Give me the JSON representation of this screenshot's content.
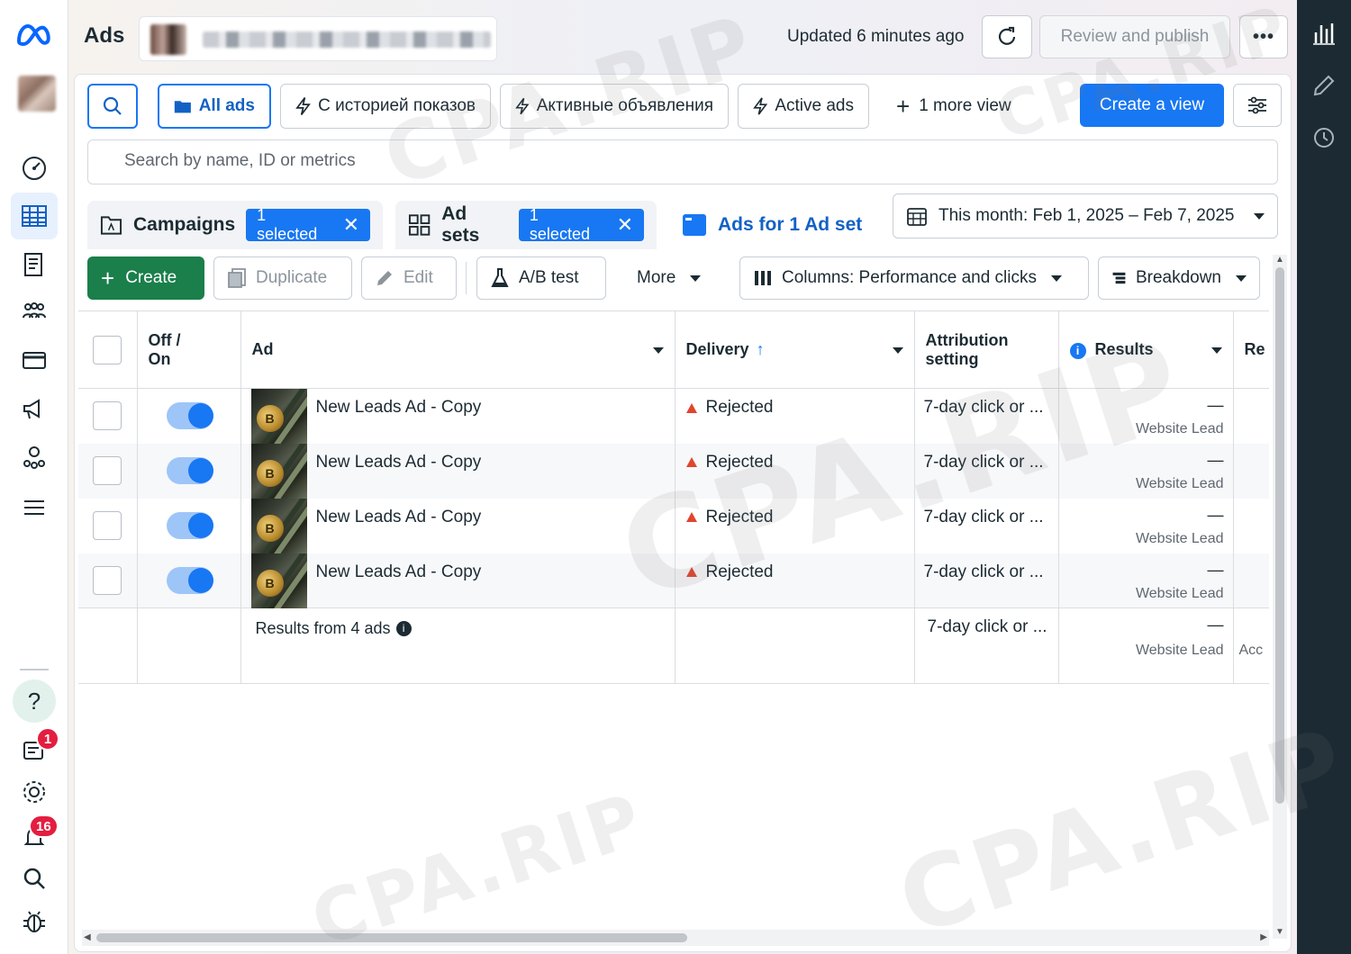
{
  "app": {
    "title": "Ads",
    "logo": "meta-logo"
  },
  "topbar": {
    "updated": "Updated 6 minutes ago",
    "review_label": "Review and publish",
    "more_label": "•••"
  },
  "views": {
    "all_ads": "All ads",
    "with_history": "С историей показов",
    "active_ru": "Активные объявления",
    "active_ads": "Active ads",
    "more_view": "1 more view",
    "create_view": "Create a view"
  },
  "search": {
    "placeholder": "Search by name, ID or metrics"
  },
  "tabs": {
    "campaigns": "Campaigns",
    "campaigns_chip": "1 selected",
    "adsets": "Ad sets",
    "adsets_chip": "1 selected",
    "ads": "Ads for 1 Ad set"
  },
  "date_range": "This month: Feb 1, 2025 – Feb 7, 2025",
  "toolbar": {
    "create": "Create",
    "duplicate": "Duplicate",
    "edit": "Edit",
    "ab_test": "A/B test",
    "more": "More",
    "columns": "Columns: Performance and clicks",
    "breakdown": "Breakdown"
  },
  "table": {
    "headers": {
      "off_on_1": "Off /",
      "off_on_2": "On",
      "ad": "Ad",
      "delivery": "Delivery",
      "attribution_1": "Attribution",
      "attribution_2": "setting",
      "results": "Results",
      "next": "Re"
    },
    "rows": [
      {
        "name": "New Leads Ad - Copy",
        "delivery": "Rejected",
        "attribution": "7-day click or ...",
        "result": "—",
        "result_type": "Website Lead",
        "on": true
      },
      {
        "name": "New Leads Ad - Copy",
        "delivery": "Rejected",
        "attribution": "7-day click or ...",
        "result": "—",
        "result_type": "Website Lead",
        "on": true
      },
      {
        "name": "New Leads Ad - Copy",
        "delivery": "Rejected",
        "attribution": "7-day click or ...",
        "result": "—",
        "result_type": "Website Lead",
        "on": true
      },
      {
        "name": "New Leads Ad - Copy",
        "delivery": "Rejected",
        "attribution": "7-day click or ...",
        "result": "—",
        "result_type": "Website Lead",
        "on": true
      }
    ],
    "summary": {
      "label": "Results from 4 ads",
      "attribution": "7-day click or ...",
      "result": "—",
      "result_type": "Website Lead",
      "next": "Acc"
    }
  },
  "notifications": {
    "inbox_badge": "1",
    "alerts_badge": "16"
  },
  "help_label": "?",
  "watermark": "CPA.RIP",
  "colors": {
    "primary": "#1877f2",
    "create_green": "#1a7f4b",
    "rejected_red": "#e0452d",
    "dark_rail": "#1c2b33"
  }
}
